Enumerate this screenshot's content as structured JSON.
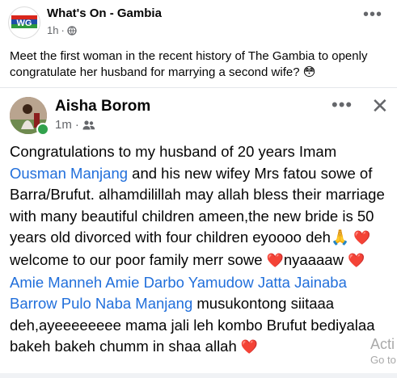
{
  "page": {
    "name": "What's On - Gambia",
    "time": "1h",
    "avatar_logo_text": "WG",
    "caption": "Meet the first woman in the recent history of The Gambia to openly congratulate her husband for marrying a second wife? 😳"
  },
  "inner_post": {
    "author": "Aisha Borom",
    "time": "1m",
    "menu_label": "•••",
    "close_label": "✕",
    "body": {
      "p1": "Congratulations to my husband of 20 years Imam ",
      "tag1": "Ousman Manjang",
      "p2": " and his new wifey Mrs fatou sowe of Barra/Brufut. alhamdilillah may allah bless their marriage with many beautiful children ameen,the new bride is 50 years old divorced with four children eyoooo deh",
      "emoji_pray": "🙏",
      "heart": "❤️",
      "p3": " welcome to our poor family merr sowe ",
      "p4": "nyaaaaw ",
      "tag2": "Amie Manneh",
      "tag3": "Amie Darbo",
      "tag4": "Yamudow Jatta",
      "tag5": "Jainaba Barrow",
      "tag6": "Pulo Naba Manjang",
      "p5": " musukontong siitaaa deh,ayeeeeeeee mama jali leh kombo Brufut bediyalaa bakeh bakeh chumm in shaa allah "
    }
  },
  "overlay": {
    "title": "Acti",
    "sub": "Go to"
  },
  "colors": {
    "link": "#216fdb",
    "heart": "#e0245e",
    "online": "#31a24c",
    "muted": "#65676b"
  }
}
